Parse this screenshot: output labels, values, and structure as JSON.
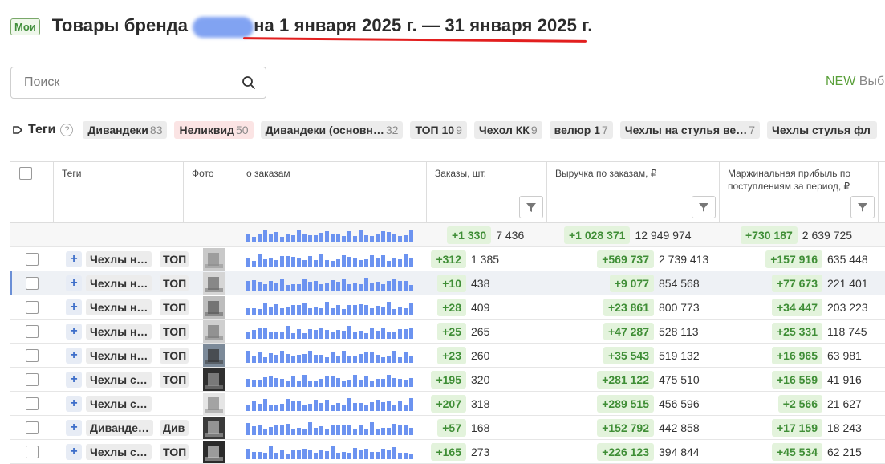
{
  "header": {
    "badge": "Мои",
    "title_prefix": "Товары бренда",
    "title_period": "на 1 января 2025 г. — 31 января 2025 г."
  },
  "search": {
    "placeholder": "Поиск"
  },
  "new_button": {
    "new": "NEW",
    "rest": " Выб"
  },
  "tags_bar": {
    "label": "Теги",
    "help": "?",
    "chips": [
      {
        "name": "Дивандеки",
        "count": "83",
        "color": "gray"
      },
      {
        "name": "Неликвид",
        "count": "50",
        "color": "red"
      },
      {
        "name": "Дивандеки (основн…",
        "count": "32",
        "color": "gray"
      },
      {
        "name": "ТОП 10",
        "count": "9",
        "color": "gray"
      },
      {
        "name": "Чехол КК",
        "count": "9",
        "color": "gray"
      },
      {
        "name": "велюр 1",
        "count": "7",
        "color": "gray"
      },
      {
        "name": "Чехлы на стулья ве…",
        "count": "7",
        "color": "gray"
      },
      {
        "name": "Чехлы стулья фл",
        "count": "",
        "color": "gray"
      }
    ]
  },
  "table": {
    "headers": {
      "tags": "Теги",
      "photo": "Фото",
      "orders_chart": "о заказам",
      "orders": "Заказы, шт.",
      "revenue": "Выручка по заказам, ₽",
      "margin": "Маржинальная прибыль по поступлениям за период, ₽"
    },
    "totals": {
      "orders_delta": "+1 330",
      "orders": "7 436",
      "revenue_delta": "+1 028 371",
      "revenue": "12 949 974",
      "margin_delta": "+730 187",
      "margin": "2 639 725"
    },
    "rows": [
      {
        "tag": "Чехлы н…",
        "tag2": "ТОП",
        "orders_delta": "+312",
        "orders": "1 385",
        "revenue_delta": "+569 737",
        "revenue": "2 739 413",
        "margin_delta": "+157 916",
        "margin": "635 448",
        "selected": false
      },
      {
        "tag": "Чехлы н…",
        "tag2": "ТОП",
        "orders_delta": "+10",
        "orders": "438",
        "revenue_delta": "+9 077",
        "revenue": "854 568",
        "margin_delta": "+77 673",
        "margin": "221 401",
        "selected": true
      },
      {
        "tag": "Чехлы н…",
        "tag2": "ТОП",
        "orders_delta": "+28",
        "orders": "409",
        "revenue_delta": "+23 861",
        "revenue": "800 773",
        "margin_delta": "+34 447",
        "margin": "203 223",
        "selected": false
      },
      {
        "tag": "Чехлы н…",
        "tag2": "ТОП",
        "orders_delta": "+25",
        "orders": "265",
        "revenue_delta": "+47 287",
        "revenue": "528 113",
        "margin_delta": "+25 331",
        "margin": "118 745",
        "selected": false
      },
      {
        "tag": "Чехлы н…",
        "tag2": "ТОП",
        "orders_delta": "+23",
        "orders": "260",
        "revenue_delta": "+35 543",
        "revenue": "519 132",
        "margin_delta": "+16 965",
        "margin": "63 981",
        "selected": false
      },
      {
        "tag": "Чехлы с…",
        "tag2": "ТОП",
        "orders_delta": "+195",
        "orders": "320",
        "revenue_delta": "+281 122",
        "revenue": "475 510",
        "margin_delta": "+16 559",
        "margin": "41 916",
        "selected": false
      },
      {
        "tag": "Чехлы с…",
        "tag2": "",
        "orders_delta": "+207",
        "orders": "318",
        "revenue_delta": "+289 515",
        "revenue": "456 596",
        "margin_delta": "+2 566",
        "margin": "21 627",
        "selected": false
      },
      {
        "tag": "Диванде…",
        "tag2": "Див",
        "orders_delta": "+57",
        "orders": "168",
        "revenue_delta": "+152 792",
        "revenue": "442 858",
        "margin_delta": "+17 159",
        "margin": "18 243",
        "selected": false
      },
      {
        "tag": "Чехлы с…",
        "tag2": "ТОП",
        "orders_delta": "+165",
        "orders": "273",
        "revenue_delta": "+226 123",
        "revenue": "394 844",
        "margin_delta": "+45 534",
        "margin": "62 215",
        "selected": false
      }
    ]
  },
  "colors": {
    "accent_green": "#3f8e36",
    "green_bg": "#e3f3dc",
    "spark_bar": "#6c93f0",
    "underline_red": "#e21f1f"
  }
}
